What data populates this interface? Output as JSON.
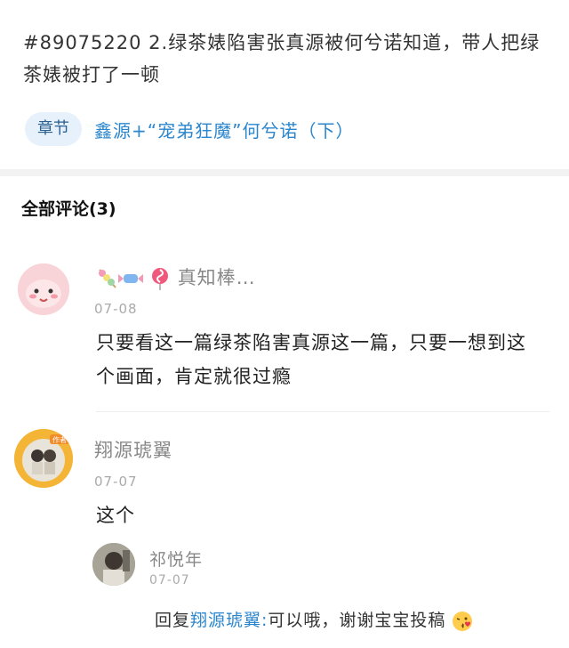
{
  "post": {
    "quote": "#89075220 2.绿茶婊陷害张真源被何兮诺知道，带人把绿茶婊被打了一顿",
    "chapter_chip": "章节",
    "chapter_title": "鑫源+“宠弟狂魔”何兮诺（下）"
  },
  "comments_header": "全部评论(3)",
  "comments": [
    {
      "name": "真知棒…",
      "date": "07-08",
      "text": "只要看这一篇绿茶陷害真源这一篇，只要一想到这个画面，肯定就很过瘾"
    },
    {
      "name": "翔源琥翼",
      "date": "07-07",
      "text": "这个",
      "badge": "作者"
    }
  ],
  "reply": {
    "name": "祁悦年",
    "date": "07-07",
    "prefix": "回复",
    "to": "翔源琥翼:",
    "text": "可以哦，谢谢宝宝投稿"
  },
  "colors": {
    "accent": "#2b86cd",
    "chip_bg": "#e6f1fb"
  },
  "icons": [
    "candy-emoji-icon",
    "kiss-emoji-icon"
  ]
}
